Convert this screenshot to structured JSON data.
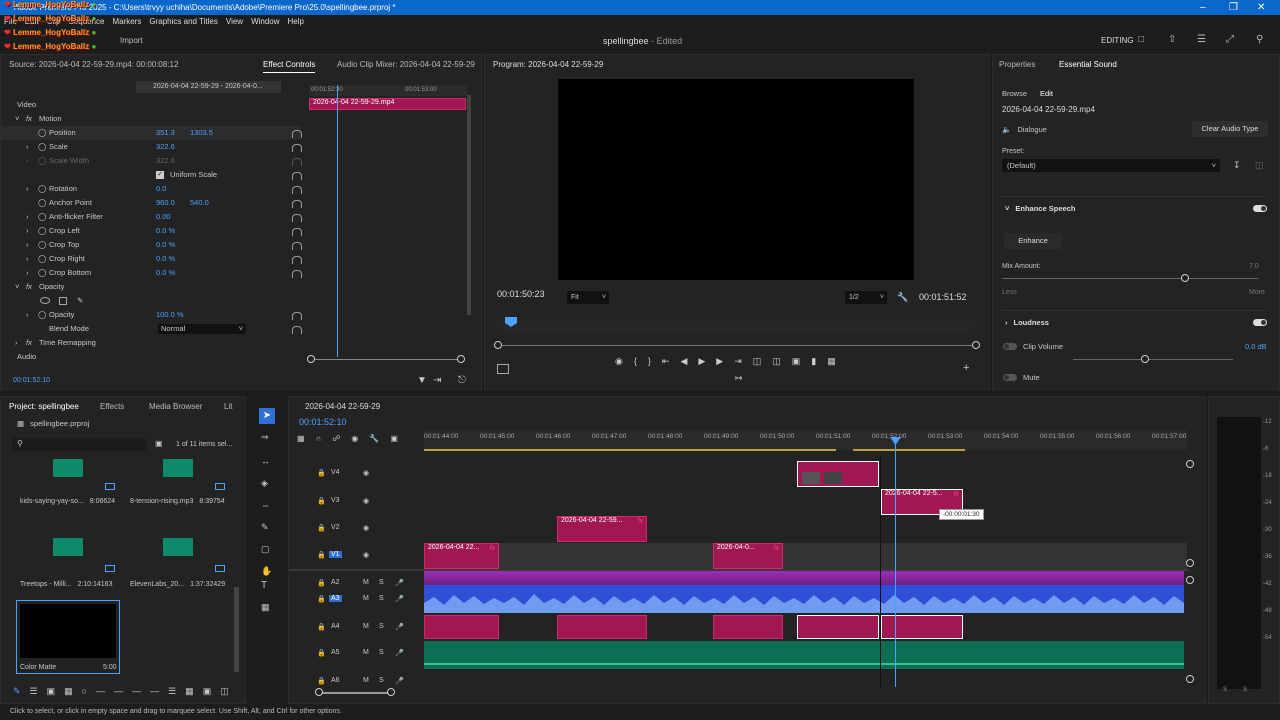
{
  "titlebar": {
    "text": "Adobe Premiere Pro 2025 - C:\\Users\\trvyy uchiha\\Documents\\Adobe\\Premiere Pro\\25.0\\spellingbee.prproj *"
  },
  "menu": [
    "File",
    "Edit",
    "Clip",
    "Sequence",
    "Markers",
    "Graphics and Titles",
    "View",
    "Window",
    "Help"
  ],
  "overlay": {
    "username": "Lemme_HogYoBallz",
    "repeat": 6
  },
  "header": {
    "import": "Import",
    "project_title": "spellingbee",
    "status": "- Edited",
    "workspace": "EDITING"
  },
  "source": {
    "label": "Source: 2026-04-04 22-59-29.mp4: 00:00:08:12",
    "tab_effect": "Effect Controls",
    "tab_mixer": "Audio Clip Mixer: 2026-04-04 22-59-29",
    "clip_path": "2026-04-04 22-59-29 - 2026-04-0...",
    "mini_time1": "00:01:52:30",
    "mini_time2": "00:01:53:00",
    "mini_clip": "2026-04-04 22-59-29.mp4",
    "timecode": "00:01:52:10"
  },
  "effects": {
    "video": "Video",
    "motion": "Motion",
    "position": "Position",
    "pos_x": "351.3",
    "pos_y": "1303.5",
    "scale": "Scale",
    "scale_v": "322.6",
    "scale_width": "Scale Width",
    "scale_width_v": "322.6",
    "uniform": "Uniform Scale",
    "rotation": "Rotation",
    "rotation_v": "0.0",
    "anchor": "Anchor Point",
    "anchor_x": "960.0",
    "anchor_y": "540.0",
    "flicker": "Anti-flicker Filter",
    "flicker_v": "0.00",
    "crop_left": "Crop Left",
    "crop_left_v": "0.0 %",
    "crop_top": "Crop Top",
    "crop_top_v": "0.0 %",
    "crop_right": "Crop Right",
    "crop_right_v": "0.0 %",
    "crop_bottom": "Crop Bottom",
    "crop_bottom_v": "0.0 %",
    "opacity": "Opacity",
    "opacity_prop": "Opacity",
    "opacity_v": "100.0 %",
    "blend": "Blend Mode",
    "blend_v": "Normal",
    "remap": "Time Remapping",
    "audio": "Audio"
  },
  "program": {
    "title": "Program: 2026-04-04 22-59-29",
    "tc_left": "00:01:50:23",
    "fit": "Fit",
    "res": "1/2",
    "tc_right": "00:01:51:52"
  },
  "essential": {
    "tab_props": "Properties",
    "tab_es": "Essential Sound",
    "browse": "Browse",
    "edit": "Edit",
    "file": "2026-04-04 22-59-29.mp4",
    "dialogue": "Dialogue",
    "clear": "Clear Audio Type",
    "preset": "Preset:",
    "preset_v": "(Default)",
    "enhance_speech": "Enhance Speech",
    "enhance": "Enhance",
    "mix": "Mix Amount:",
    "mix_v": "7.0",
    "less": "Less",
    "more": "More",
    "loudness": "Loudness",
    "clip_volume": "Clip Volume",
    "clip_volume_v": "0.0 dB",
    "mute": "Mute"
  },
  "project": {
    "tab_project": "Project: spellingbee",
    "tab_effects": "Effects",
    "tab_media": "Media Browser",
    "tab_lib": "Lit",
    "file": "spellingbee.prproj",
    "count": "1 of 11 items sel...",
    "items": [
      {
        "name": "kids-saying-yay-so...",
        "dur": "8:06624"
      },
      {
        "name": "8-tension-rising.mp3",
        "dur": "8:39754"
      },
      {
        "name": "Treetops - Milli...",
        "dur": "2:10:14163"
      },
      {
        "name": "ElevenLabs_20...",
        "dur": "1:37:32429"
      },
      {
        "name": "Color Matte",
        "dur": "5:00"
      }
    ]
  },
  "timeline": {
    "tab": "2026-04-04 22-59-29",
    "timecode": "00:01:52:10",
    "ruler": [
      "00:01:44:00",
      "00:01:45:00",
      "00:01:46:00",
      "00:01:47:00",
      "00:01:48:00",
      "00:01:49:00",
      "00:01:50:00",
      "00:01:51:00",
      "00:01:52:00",
      "00:01:53:00",
      "00:01:54:00",
      "00:01:55:00",
      "00:01:56:00",
      "00:01:57:00"
    ],
    "tracks": [
      "V4",
      "V3",
      "V2",
      "V1",
      "A2",
      "A3",
      "A4",
      "A5",
      "A6"
    ],
    "clip1": "2026-04-04 22-5...",
    "clip2": "2026-04-04 22-59...",
    "clip3": "2026-04-04 22...",
    "clip4": "2026-04-0...",
    "tooltip": "-00:00:01:30"
  },
  "meter": [
    "-12",
    "-6",
    "-18",
    "-24",
    "-30",
    "-36",
    "-42",
    "-48",
    "-54",
    "S",
    "S"
  ],
  "status": "Click to select, or click in empty space and drag to marquee select. Use Shift, Alt, and Ctrl for other options.",
  "colors": {
    "accent": "#0b67c9",
    "clip": "#a01752",
    "audio_blue": "#2f4fd6",
    "audio_green": "#0c6e55",
    "audio_purple": "#7a1f8a"
  }
}
